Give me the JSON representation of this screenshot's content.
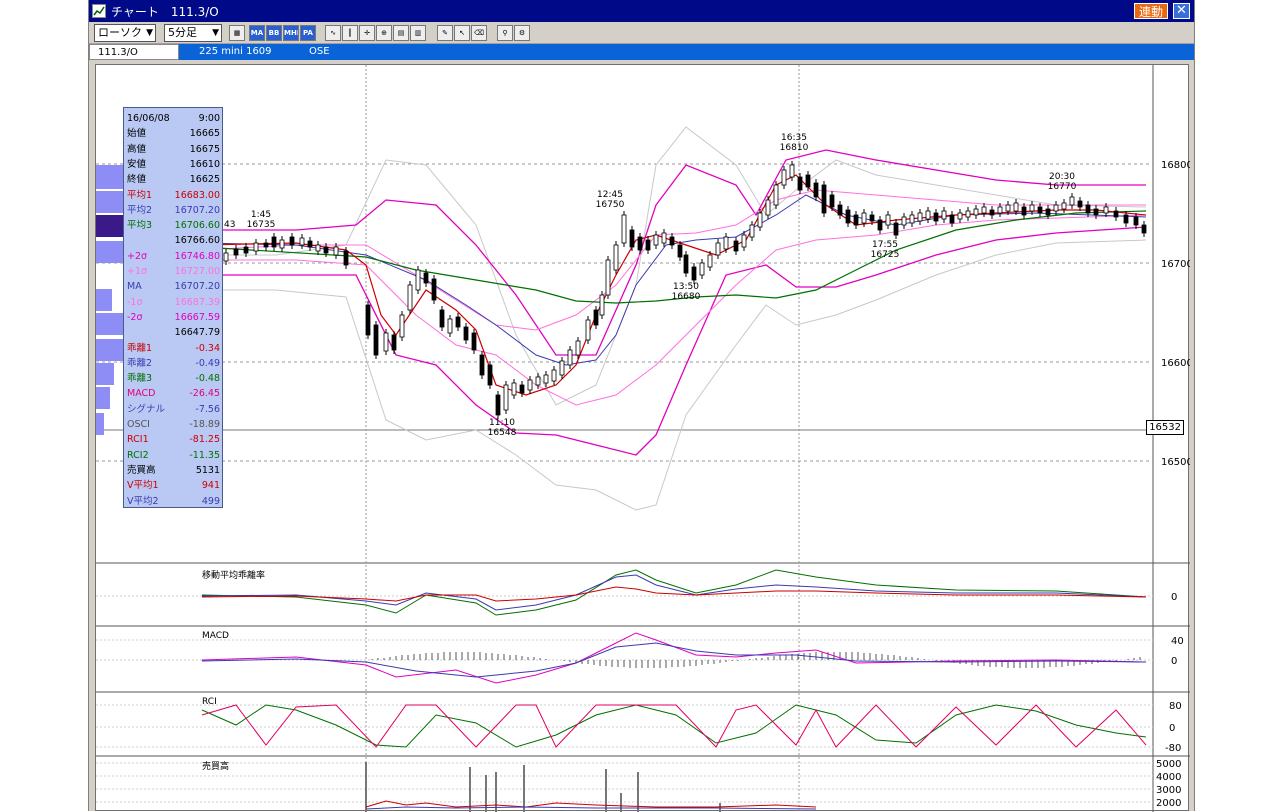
{
  "window": {
    "title": "チャート　111.3/O",
    "link_button": "連動",
    "close_glyph": "✕"
  },
  "toolbar": {
    "chart_type": "ローソク",
    "interval": "5分足",
    "buttons": [
      "layout-icon",
      "MA",
      "BB",
      "MHE",
      "PA",
      "line-icon",
      "candle-icon",
      "cursor-icon",
      "zoom-icon",
      "print-icon",
      "bar-icon",
      "pen-icon",
      "select-icon",
      "eraser-icon",
      "search-icon",
      "settings-icon"
    ],
    "button_labels": {
      "ma": "MA",
      "bb": "BB",
      "mhe": "MHE",
      "pa": "PA"
    }
  },
  "infobar": {
    "symbol": "111.3/O",
    "contract": "225 mini 1609",
    "exchange": "OSE"
  },
  "data_window": {
    "rows": [
      {
        "label": "16/06/08",
        "value": "9:00",
        "color": "#000000"
      },
      {
        "label": "始値",
        "value": "16665",
        "color": "#000000"
      },
      {
        "label": "高値",
        "value": "16675",
        "color": "#000000"
      },
      {
        "label": "安値",
        "value": "16610",
        "color": "#000000"
      },
      {
        "label": "終値",
        "value": "16625",
        "color": "#000000"
      },
      {
        "label": "平均1",
        "value": "16683.00",
        "color": "#cc0000"
      },
      {
        "label": "平均2",
        "value": "16707.20",
        "color": "#3a3ab0"
      },
      {
        "label": "平均3",
        "value": "16706.60",
        "color": "#007000"
      },
      {
        "label": "",
        "value": "16766.60",
        "color": "#000000"
      },
      {
        "label": "+2σ",
        "value": "16746.80",
        "color": "#e000c0"
      },
      {
        "label": "+1σ",
        "value": "16727.00",
        "color": "#ff70e0"
      },
      {
        "label": "MA",
        "value": "16707.20",
        "color": "#3a3ab0"
      },
      {
        "label": "-1σ",
        "value": "16687.39",
        "color": "#ff70e0"
      },
      {
        "label": "-2σ",
        "value": "16667.59",
        "color": "#e000c0"
      },
      {
        "label": "",
        "value": "16647.79",
        "color": "#000000"
      },
      {
        "label": "乖離1",
        "value": "-0.34",
        "color": "#cc0000"
      },
      {
        "label": "乖離2",
        "value": "-0.49",
        "color": "#3a3ab0"
      },
      {
        "label": "乖離3",
        "value": "-0.48",
        "color": "#007000"
      },
      {
        "label": "MACD",
        "value": "-26.45",
        "color": "#e00080"
      },
      {
        "label": "シグナル",
        "value": "-7.56",
        "color": "#3a3ab0"
      },
      {
        "label": "OSCI",
        "value": "-18.89",
        "color": "#555555"
      },
      {
        "label": "RCI1",
        "value": "-81.25",
        "color": "#cc0000"
      },
      {
        "label": "RCI2",
        "value": "-11.35",
        "color": "#007000"
      },
      {
        "label": "売買高",
        "value": "5131",
        "color": "#000000"
      },
      {
        "label": "V平均1",
        "value": "941",
        "color": "#cc0000"
      },
      {
        "label": "V平均2",
        "value": "499",
        "color": "#3a3ab0"
      }
    ]
  },
  "price_axis": {
    "ticks": [
      "16800",
      "16700",
      "16600",
      "16500"
    ],
    "current_price": "16532"
  },
  "annotations": [
    {
      "time": "1:45",
      "price": "16735"
    },
    {
      "time": "11:10",
      "price": "16548"
    },
    {
      "time": "12:45",
      "price": "16750"
    },
    {
      "time": "13:50",
      "price": "16680"
    },
    {
      "time": "16:35",
      "price": "16810"
    },
    {
      "time": "17:55",
      "price": "16725"
    },
    {
      "time": "20:30",
      "price": "16770"
    }
  ],
  "cut_label": "43",
  "panes": {
    "deviation": {
      "title": "移動平均乖離率",
      "ticks": [
        "0"
      ]
    },
    "macd": {
      "title": "MACD",
      "ticks": [
        "40",
        "0"
      ]
    },
    "rci": {
      "title": "RCI",
      "ticks": [
        "80",
        "0",
        "-80"
      ]
    },
    "volume": {
      "title": "売買高",
      "ticks": [
        "5000",
        "4000",
        "3000",
        "2000"
      ]
    }
  },
  "colors": {
    "title_bar": "#000a88",
    "info_bar": "#0a64d8",
    "ma_short": "#cc0000",
    "ma_mid": "#3a3ab0",
    "ma_long": "#007000",
    "band_2sigma": "#e000c0",
    "band_1sigma": "#ff70e0",
    "band_3sigma": "#c8c8c8"
  }
}
